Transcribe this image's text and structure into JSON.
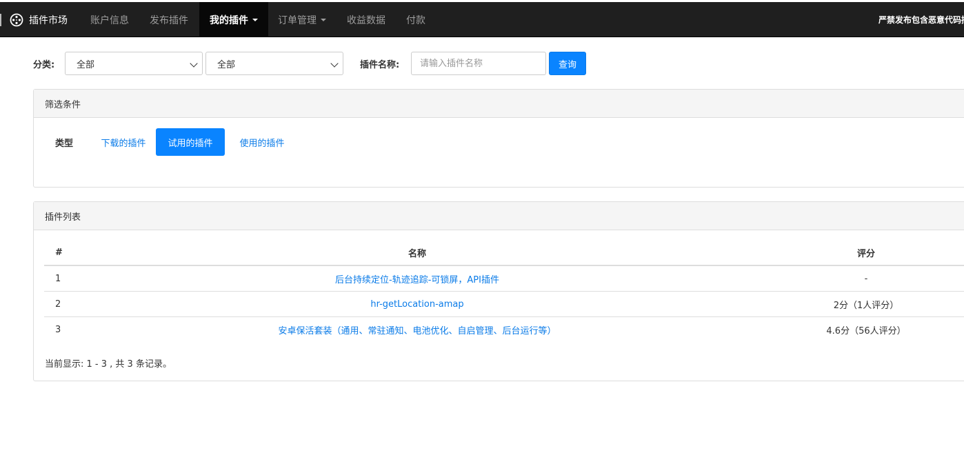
{
  "nav": {
    "brand": "插件市场",
    "items": [
      {
        "label": "账户信息",
        "active": false,
        "dropdown": false
      },
      {
        "label": "发布插件",
        "active": false,
        "dropdown": false
      },
      {
        "label": "我的插件",
        "active": true,
        "dropdown": true
      },
      {
        "label": "订单管理",
        "active": false,
        "dropdown": true
      },
      {
        "label": "收益数据",
        "active": false,
        "dropdown": false
      },
      {
        "label": "付款",
        "active": false,
        "dropdown": false
      }
    ],
    "notice": "严禁发布包含恶意代码插"
  },
  "filter": {
    "category_label": "分类:",
    "category_primary": "全部",
    "category_secondary": "全部",
    "name_label": "插件名称:",
    "name_placeholder": "请输入插件名称",
    "search_button": "查询"
  },
  "conditions": {
    "title": "筛选条件",
    "type_label": "类型",
    "types": [
      {
        "label": "下载的插件",
        "active": false
      },
      {
        "label": "试用的插件",
        "active": true
      },
      {
        "label": "使用的插件",
        "active": false
      }
    ]
  },
  "plugin_list": {
    "title": "插件列表",
    "columns": {
      "num": "#",
      "name": "名称",
      "score": "评分"
    },
    "rows": [
      {
        "num": "1",
        "name": "后台持续定位-轨迹追踪-可锁屏，API插件",
        "score": "-"
      },
      {
        "num": "2",
        "name": "hr-getLocation-amap",
        "score": "2分（1人评分）"
      },
      {
        "num": "3",
        "name": "安卓保活套装（通用、常驻通知、电池优化、自启管理、后台运行等）",
        "score": "4.6分（56人评分）"
      }
    ],
    "summary": "当前显示: 1 - 3 , 共 3 条记录。"
  },
  "colors": {
    "primary": "#0a84ff",
    "link": "#0a7be8",
    "navbar": "#1f1f1f"
  }
}
